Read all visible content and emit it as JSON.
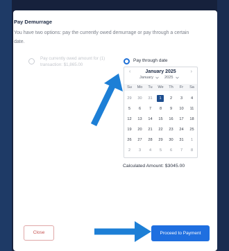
{
  "modal": {
    "title": "Pay Demurrage",
    "description": "You have two options: pay the currently owed demurrage or pay through a certain date."
  },
  "options": {
    "current": {
      "label": "Pay currently owed amount for (1) transaction: $1,865.00",
      "selected": false
    },
    "through_date": {
      "label": "Pay through date",
      "selected": true
    }
  },
  "calendar": {
    "month_title": "January 2025",
    "month_select": "January",
    "year_select": "2025",
    "prev_icon": "‹",
    "next_icon": "›",
    "weekdays": [
      "Su",
      "Mo",
      "Tu",
      "We",
      "Th",
      "Fr",
      "Sa"
    ],
    "days": [
      {
        "d": "29",
        "muted": true
      },
      {
        "d": "30",
        "muted": true
      },
      {
        "d": "31",
        "muted": true
      },
      {
        "d": "1",
        "selected": true
      },
      {
        "d": "2"
      },
      {
        "d": "3"
      },
      {
        "d": "4"
      },
      {
        "d": "5"
      },
      {
        "d": "6"
      },
      {
        "d": "7"
      },
      {
        "d": "8"
      },
      {
        "d": "9"
      },
      {
        "d": "10"
      },
      {
        "d": "11"
      },
      {
        "d": "12"
      },
      {
        "d": "13"
      },
      {
        "d": "14"
      },
      {
        "d": "15"
      },
      {
        "d": "16"
      },
      {
        "d": "17"
      },
      {
        "d": "18"
      },
      {
        "d": "19"
      },
      {
        "d": "20"
      },
      {
        "d": "21"
      },
      {
        "d": "22"
      },
      {
        "d": "23"
      },
      {
        "d": "24"
      },
      {
        "d": "25"
      },
      {
        "d": "26"
      },
      {
        "d": "27"
      },
      {
        "d": "28"
      },
      {
        "d": "29"
      },
      {
        "d": "30"
      },
      {
        "d": "31"
      },
      {
        "d": "1",
        "muted": true
      },
      {
        "d": "2",
        "muted": true
      },
      {
        "d": "3",
        "muted": true
      },
      {
        "d": "4",
        "muted": true
      },
      {
        "d": "5",
        "muted": true
      },
      {
        "d": "6",
        "muted": true
      },
      {
        "d": "7",
        "muted": true
      },
      {
        "d": "8",
        "muted": true
      }
    ]
  },
  "calculated": "Calculated Amount: $3045.00",
  "buttons": {
    "close": "Close",
    "proceed": "Proceed to Payment"
  },
  "colors": {
    "accent": "#1f6fe0",
    "annotation_arrow": "#1d7fd6",
    "selected_day": "#1d4e8f",
    "close_text": "#c5514f"
  },
  "icons": {
    "chevron": "chevron-down-icon",
    "annotation": "arrow-icon"
  }
}
